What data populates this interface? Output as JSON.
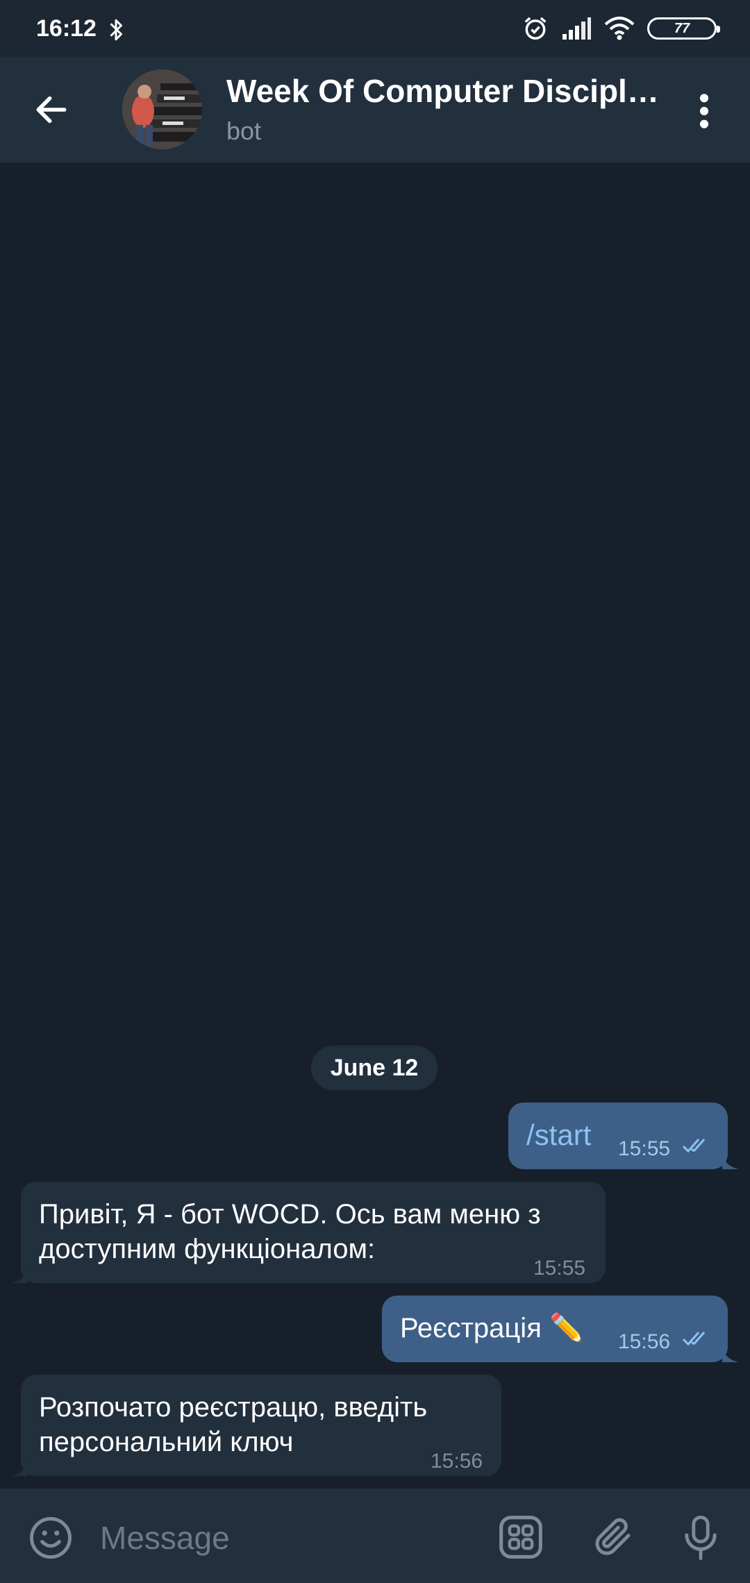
{
  "status_bar": {
    "time": "16:12",
    "battery": "77"
  },
  "header": {
    "title": "Week Of Computer Discipl…",
    "subtitle": "bot"
  },
  "date_separator": "June 12",
  "messages": [
    {
      "direction": "out",
      "text": "/start",
      "time": "15:55",
      "read": true
    },
    {
      "direction": "in",
      "lines": [
        "Привіт, Я - бот WOCD. Ось вам меню з",
        "доступним функціоналом:"
      ],
      "time": "15:55"
    },
    {
      "direction": "out",
      "text": "Реєстрація ✏️",
      "time": "15:56",
      "read": true
    },
    {
      "direction": "in",
      "lines": [
        "Розпочато реєстрацю, введіть",
        "персональний ключ"
      ],
      "time": "15:56"
    }
  ],
  "input": {
    "placeholder": "Message"
  },
  "icons": [
    "back-arrow-icon",
    "more-vertical-icon",
    "emoji-icon",
    "bot-keyboard-icon",
    "attach-icon",
    "microphone-icon"
  ]
}
